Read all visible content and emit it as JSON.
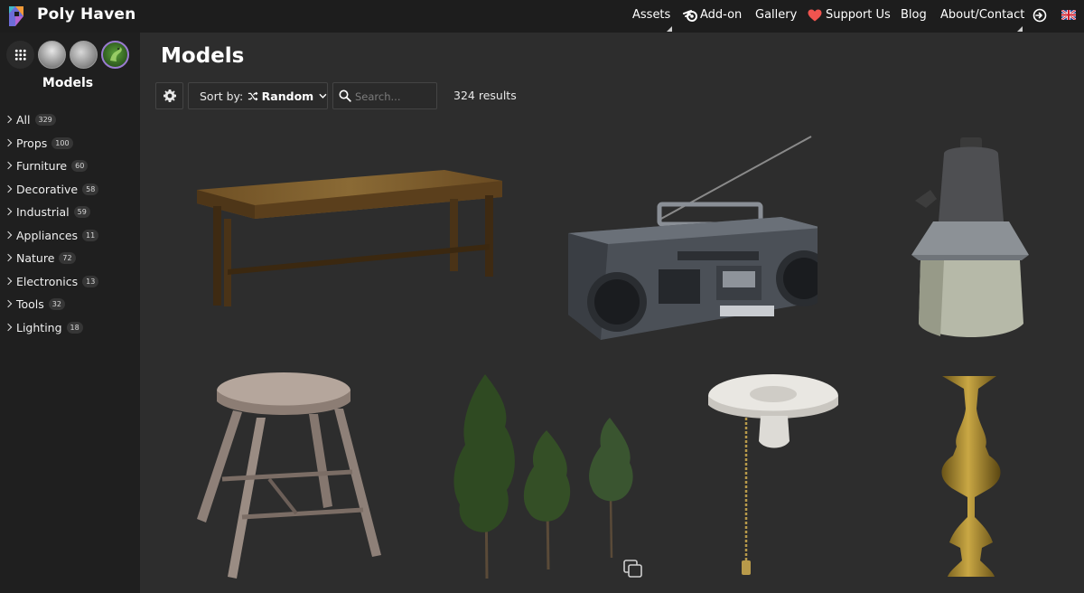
{
  "header": {
    "brand": "Poly Haven",
    "nav": [
      {
        "label": "Assets"
      },
      {
        "label": "Add-on"
      },
      {
        "label": "Gallery"
      },
      {
        "label": "Support Us"
      },
      {
        "label": "Blog"
      },
      {
        "label": "About/Contact"
      }
    ],
    "icons": [
      "poly-haven-logo-icon",
      "blender-icon",
      "heart-icon",
      "login-icon",
      "uk-flag-icon"
    ],
    "colors": {
      "bar": "#1d1d1d",
      "heart": "#f0544f",
      "accent": "#9a7bd0"
    }
  },
  "sidebar": {
    "asset_types": [
      "all-types-icon",
      "hdris-icon",
      "textures-icon",
      "models-icon"
    ],
    "title": "Models",
    "categories": [
      {
        "label": "All",
        "count": "329"
      },
      {
        "label": "Props",
        "count": "100"
      },
      {
        "label": "Furniture",
        "count": "60"
      },
      {
        "label": "Decorative",
        "count": "58"
      },
      {
        "label": "Industrial",
        "count": "59"
      },
      {
        "label": "Appliances",
        "count": "11"
      },
      {
        "label": "Nature",
        "count": "72"
      },
      {
        "label": "Electronics",
        "count": "13"
      },
      {
        "label": "Tools",
        "count": "32"
      },
      {
        "label": "Lighting",
        "count": "18"
      }
    ]
  },
  "main": {
    "title": "Models",
    "sort_label": "Sort by:",
    "sort_value": "Random",
    "search_placeholder": "Search...",
    "results": "324 results",
    "models": [
      {
        "name": "wooden-bench"
      },
      {
        "name": "boombox"
      },
      {
        "name": "industrial-lamp"
      },
      {
        "name": "wooden-stool"
      },
      {
        "name": "pine-trees"
      },
      {
        "name": "ceramic-light-socket"
      },
      {
        "name": "brass-vase"
      }
    ]
  }
}
